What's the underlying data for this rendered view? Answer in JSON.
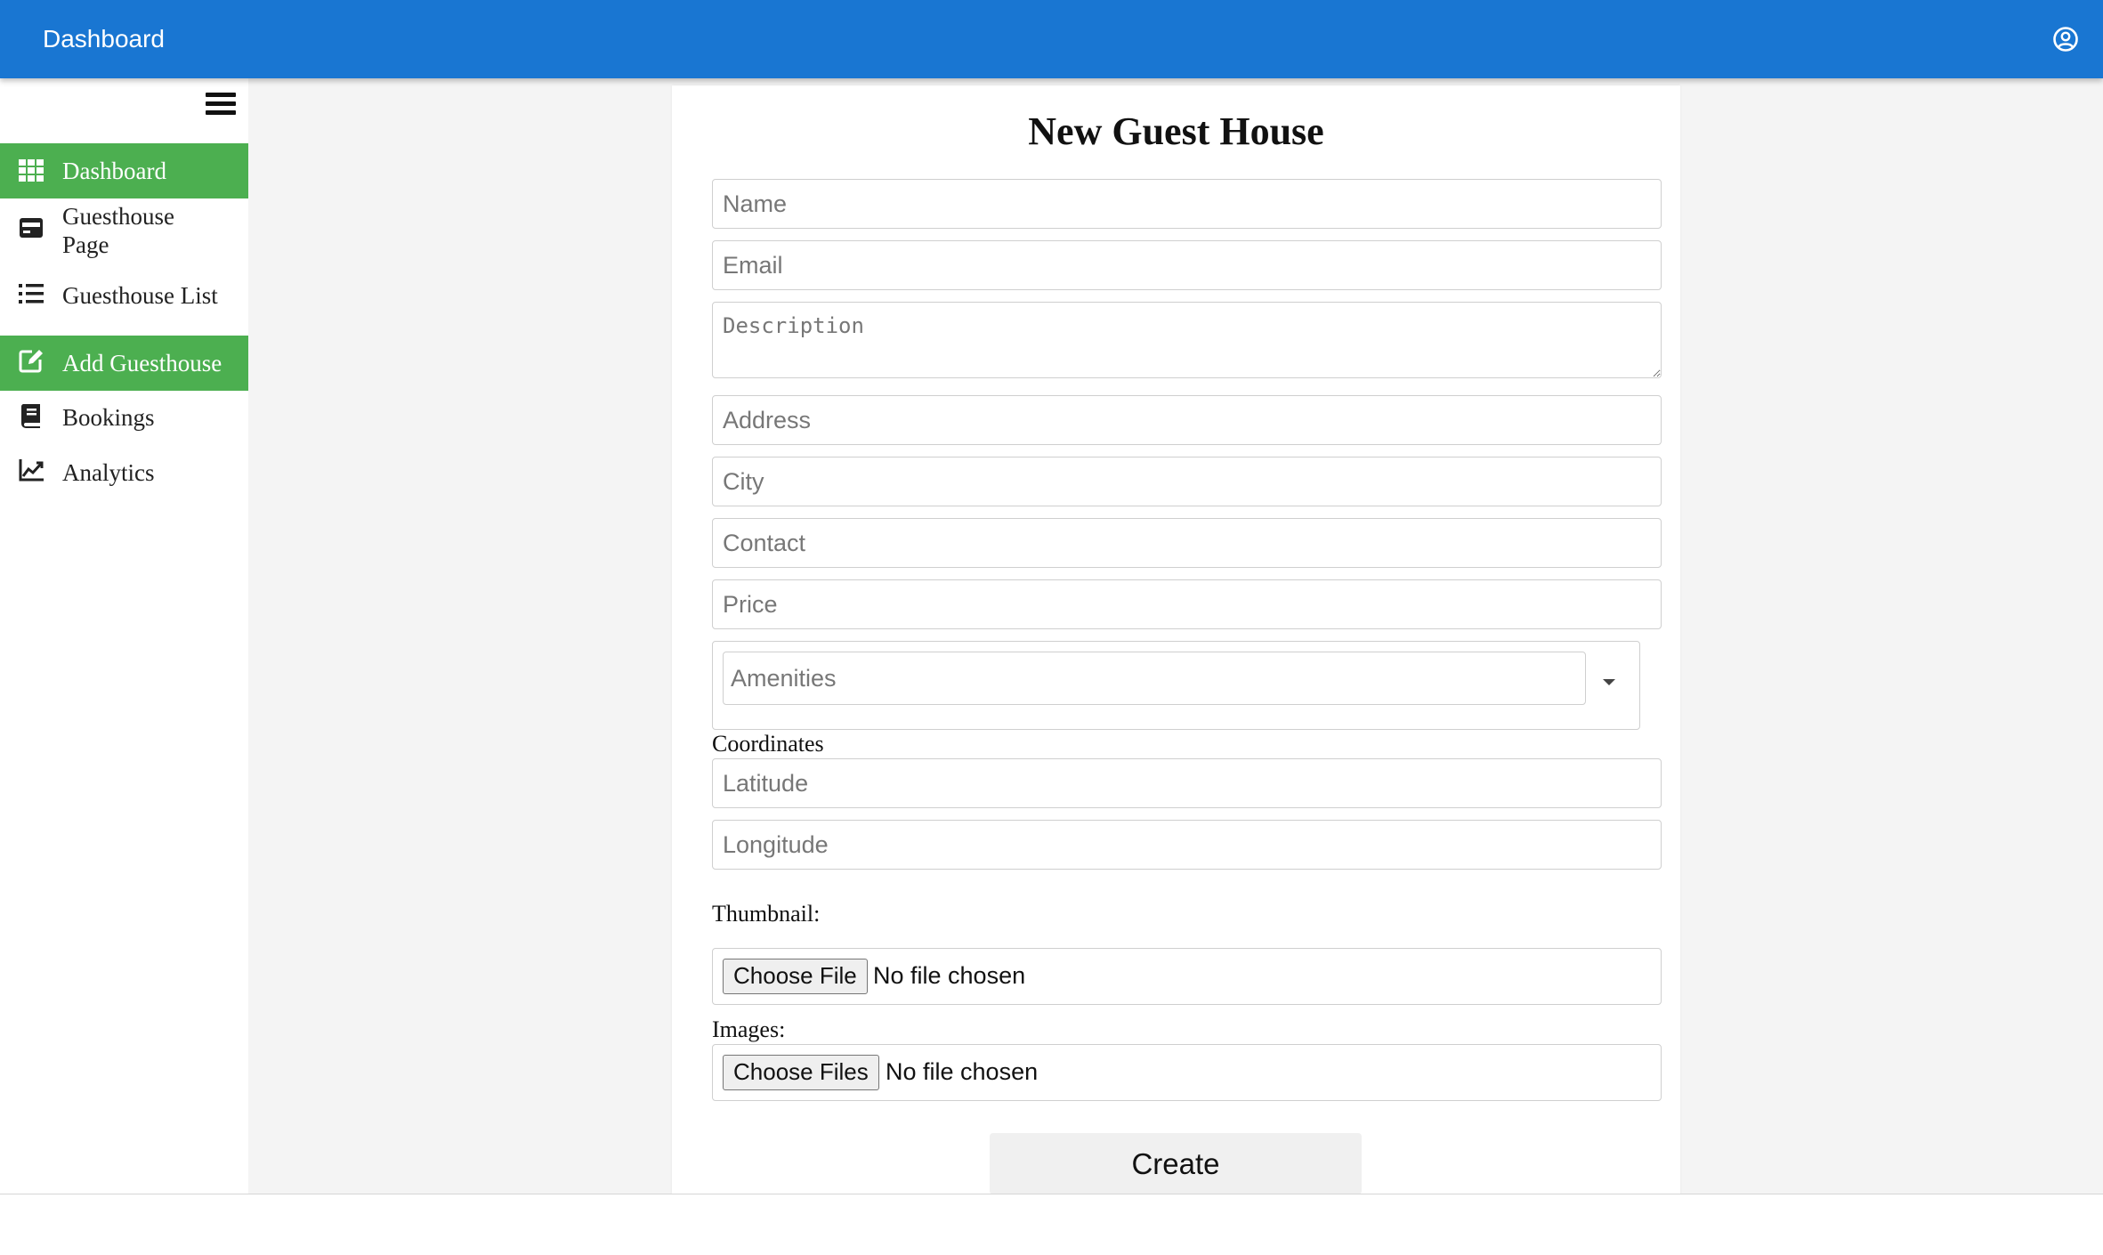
{
  "header": {
    "title": "Dashboard",
    "account_icon": "account-circle-icon",
    "color": "#1976d2"
  },
  "sidebar": {
    "menu_icon": "menu-icon",
    "items": [
      {
        "label": "Dashboard",
        "icon": "grid-icon",
        "active": true
      },
      {
        "label": "Guesthouse Page",
        "icon": "card-icon",
        "active": false
      },
      {
        "label": "Guesthouse List",
        "icon": "list-icon",
        "active": false
      },
      {
        "label": "Add Guesthouse",
        "icon": "edit-icon",
        "active": true
      },
      {
        "label": "Bookings",
        "icon": "book-icon",
        "active": false
      },
      {
        "label": "Analytics",
        "icon": "chart-line-icon",
        "active": false
      }
    ],
    "active_color": "#4caf50"
  },
  "form": {
    "title": "New Guest House",
    "name_placeholder": "Name",
    "email_placeholder": "Email",
    "description_placeholder": "Description",
    "address_placeholder": "Address",
    "city_placeholder": "City",
    "contact_placeholder": "Contact",
    "price_placeholder": "Price",
    "amenities_placeholder": "Amenities",
    "coordinates_label": "Coordinates",
    "latitude_placeholder": "Latitude",
    "longitude_placeholder": "Longitude",
    "thumbnail_label": "Thumbnail:",
    "thumbnail_button": "Choose File",
    "thumbnail_status": "No file chosen",
    "images_label": "Images:",
    "images_button": "Choose Files",
    "images_status": "No file chosen",
    "submit_label": "Create"
  }
}
